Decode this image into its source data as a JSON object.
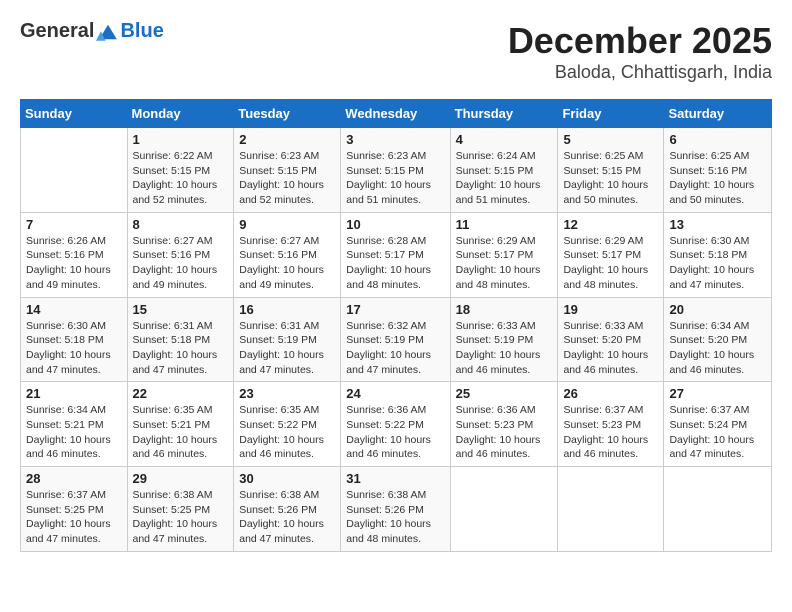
{
  "logo": {
    "general": "General",
    "blue": "Blue"
  },
  "header": {
    "month": "December 2025",
    "location": "Baloda, Chhattisgarh, India"
  },
  "weekdays": [
    "Sunday",
    "Monday",
    "Tuesday",
    "Wednesday",
    "Thursday",
    "Friday",
    "Saturday"
  ],
  "weeks": [
    [
      {
        "day": "",
        "sunrise": "",
        "sunset": "",
        "daylight": ""
      },
      {
        "day": "1",
        "sunrise": "Sunrise: 6:22 AM",
        "sunset": "Sunset: 5:15 PM",
        "daylight": "Daylight: 10 hours and 52 minutes."
      },
      {
        "day": "2",
        "sunrise": "Sunrise: 6:23 AM",
        "sunset": "Sunset: 5:15 PM",
        "daylight": "Daylight: 10 hours and 52 minutes."
      },
      {
        "day": "3",
        "sunrise": "Sunrise: 6:23 AM",
        "sunset": "Sunset: 5:15 PM",
        "daylight": "Daylight: 10 hours and 51 minutes."
      },
      {
        "day": "4",
        "sunrise": "Sunrise: 6:24 AM",
        "sunset": "Sunset: 5:15 PM",
        "daylight": "Daylight: 10 hours and 51 minutes."
      },
      {
        "day": "5",
        "sunrise": "Sunrise: 6:25 AM",
        "sunset": "Sunset: 5:15 PM",
        "daylight": "Daylight: 10 hours and 50 minutes."
      },
      {
        "day": "6",
        "sunrise": "Sunrise: 6:25 AM",
        "sunset": "Sunset: 5:16 PM",
        "daylight": "Daylight: 10 hours and 50 minutes."
      }
    ],
    [
      {
        "day": "7",
        "sunrise": "Sunrise: 6:26 AM",
        "sunset": "Sunset: 5:16 PM",
        "daylight": "Daylight: 10 hours and 49 minutes."
      },
      {
        "day": "8",
        "sunrise": "Sunrise: 6:27 AM",
        "sunset": "Sunset: 5:16 PM",
        "daylight": "Daylight: 10 hours and 49 minutes."
      },
      {
        "day": "9",
        "sunrise": "Sunrise: 6:27 AM",
        "sunset": "Sunset: 5:16 PM",
        "daylight": "Daylight: 10 hours and 49 minutes."
      },
      {
        "day": "10",
        "sunrise": "Sunrise: 6:28 AM",
        "sunset": "Sunset: 5:17 PM",
        "daylight": "Daylight: 10 hours and 48 minutes."
      },
      {
        "day": "11",
        "sunrise": "Sunrise: 6:29 AM",
        "sunset": "Sunset: 5:17 PM",
        "daylight": "Daylight: 10 hours and 48 minutes."
      },
      {
        "day": "12",
        "sunrise": "Sunrise: 6:29 AM",
        "sunset": "Sunset: 5:17 PM",
        "daylight": "Daylight: 10 hours and 48 minutes."
      },
      {
        "day": "13",
        "sunrise": "Sunrise: 6:30 AM",
        "sunset": "Sunset: 5:18 PM",
        "daylight": "Daylight: 10 hours and 47 minutes."
      }
    ],
    [
      {
        "day": "14",
        "sunrise": "Sunrise: 6:30 AM",
        "sunset": "Sunset: 5:18 PM",
        "daylight": "Daylight: 10 hours and 47 minutes."
      },
      {
        "day": "15",
        "sunrise": "Sunrise: 6:31 AM",
        "sunset": "Sunset: 5:18 PM",
        "daylight": "Daylight: 10 hours and 47 minutes."
      },
      {
        "day": "16",
        "sunrise": "Sunrise: 6:31 AM",
        "sunset": "Sunset: 5:19 PM",
        "daylight": "Daylight: 10 hours and 47 minutes."
      },
      {
        "day": "17",
        "sunrise": "Sunrise: 6:32 AM",
        "sunset": "Sunset: 5:19 PM",
        "daylight": "Daylight: 10 hours and 47 minutes."
      },
      {
        "day": "18",
        "sunrise": "Sunrise: 6:33 AM",
        "sunset": "Sunset: 5:19 PM",
        "daylight": "Daylight: 10 hours and 46 minutes."
      },
      {
        "day": "19",
        "sunrise": "Sunrise: 6:33 AM",
        "sunset": "Sunset: 5:20 PM",
        "daylight": "Daylight: 10 hours and 46 minutes."
      },
      {
        "day": "20",
        "sunrise": "Sunrise: 6:34 AM",
        "sunset": "Sunset: 5:20 PM",
        "daylight": "Daylight: 10 hours and 46 minutes."
      }
    ],
    [
      {
        "day": "21",
        "sunrise": "Sunrise: 6:34 AM",
        "sunset": "Sunset: 5:21 PM",
        "daylight": "Daylight: 10 hours and 46 minutes."
      },
      {
        "day": "22",
        "sunrise": "Sunrise: 6:35 AM",
        "sunset": "Sunset: 5:21 PM",
        "daylight": "Daylight: 10 hours and 46 minutes."
      },
      {
        "day": "23",
        "sunrise": "Sunrise: 6:35 AM",
        "sunset": "Sunset: 5:22 PM",
        "daylight": "Daylight: 10 hours and 46 minutes."
      },
      {
        "day": "24",
        "sunrise": "Sunrise: 6:36 AM",
        "sunset": "Sunset: 5:22 PM",
        "daylight": "Daylight: 10 hours and 46 minutes."
      },
      {
        "day": "25",
        "sunrise": "Sunrise: 6:36 AM",
        "sunset": "Sunset: 5:23 PM",
        "daylight": "Daylight: 10 hours and 46 minutes."
      },
      {
        "day": "26",
        "sunrise": "Sunrise: 6:37 AM",
        "sunset": "Sunset: 5:23 PM",
        "daylight": "Daylight: 10 hours and 46 minutes."
      },
      {
        "day": "27",
        "sunrise": "Sunrise: 6:37 AM",
        "sunset": "Sunset: 5:24 PM",
        "daylight": "Daylight: 10 hours and 47 minutes."
      }
    ],
    [
      {
        "day": "28",
        "sunrise": "Sunrise: 6:37 AM",
        "sunset": "Sunset: 5:25 PM",
        "daylight": "Daylight: 10 hours and 47 minutes."
      },
      {
        "day": "29",
        "sunrise": "Sunrise: 6:38 AM",
        "sunset": "Sunset: 5:25 PM",
        "daylight": "Daylight: 10 hours and 47 minutes."
      },
      {
        "day": "30",
        "sunrise": "Sunrise: 6:38 AM",
        "sunset": "Sunset: 5:26 PM",
        "daylight": "Daylight: 10 hours and 47 minutes."
      },
      {
        "day": "31",
        "sunrise": "Sunrise: 6:38 AM",
        "sunset": "Sunset: 5:26 PM",
        "daylight": "Daylight: 10 hours and 48 minutes."
      },
      {
        "day": "",
        "sunrise": "",
        "sunset": "",
        "daylight": ""
      },
      {
        "day": "",
        "sunrise": "",
        "sunset": "",
        "daylight": ""
      },
      {
        "day": "",
        "sunrise": "",
        "sunset": "",
        "daylight": ""
      }
    ]
  ]
}
